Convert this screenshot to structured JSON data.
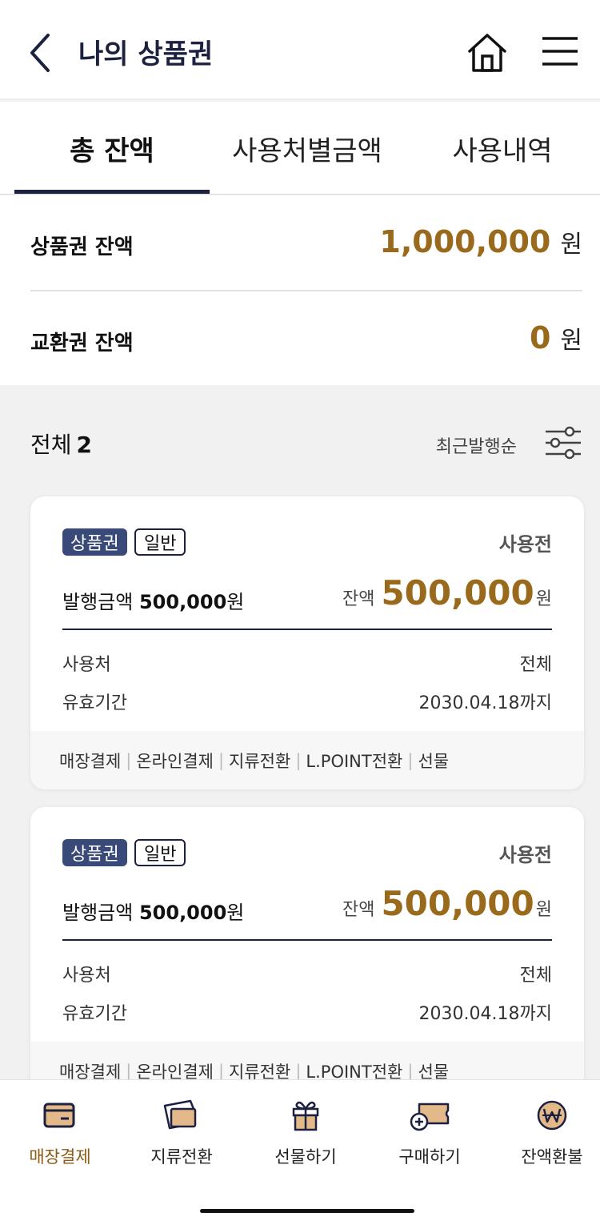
{
  "header": {
    "title": "나의 상품권",
    "back_icon": "chevron-left-icon",
    "home_icon": "home-icon",
    "menu_icon": "hamburger-menu-icon"
  },
  "tabs": [
    {
      "label": "총 잔액",
      "active": true
    },
    {
      "label": "사용처별금액",
      "active": false
    },
    {
      "label": "사용내역",
      "active": false
    }
  ],
  "balance": {
    "gift_label": "상품권 잔액",
    "gift_amount": "1,000,000",
    "exchange_label": "교환권 잔액",
    "exchange_amount": "0",
    "unit": "원"
  },
  "list": {
    "total_label": "전체",
    "total_count": "2",
    "sort_label": "최근발행순",
    "filter_icon": "filter-sliders-icon"
  },
  "cards": [
    {
      "badge_main": "상품권",
      "badge_sub": "일반",
      "status": "사용전",
      "issue_label": "발행금액",
      "issue_amount": "500,000",
      "issue_unit": "원",
      "remain_label": "잔액",
      "remain_amount": "500,000",
      "remain_unit": "원",
      "place_label": "사용처",
      "place_value": "전체",
      "expiry_label": "유효기간",
      "expiry_value": "2030.04.18까지",
      "actions": [
        "매장결제",
        "온라인결제",
        "지류전환",
        "L.POINT전환",
        "선물"
      ]
    },
    {
      "badge_main": "상품권",
      "badge_sub": "일반",
      "status": "사용전",
      "issue_label": "발행금액",
      "issue_amount": "500,000",
      "issue_unit": "원",
      "remain_label": "잔액",
      "remain_amount": "500,000",
      "remain_unit": "원",
      "place_label": "사용처",
      "place_value": "전체",
      "expiry_label": "유효기간",
      "expiry_value": "2030.04.18까지",
      "actions": [
        "매장결제",
        "온라인결제",
        "지류전환",
        "L.POINT전환",
        "선물"
      ]
    }
  ],
  "bottom_nav": [
    {
      "label": "매장결제",
      "icon": "card-payment-icon",
      "active": true
    },
    {
      "label": "지류전환",
      "icon": "ticket-convert-icon",
      "active": false
    },
    {
      "label": "선물하기",
      "icon": "gift-icon",
      "active": false
    },
    {
      "label": "구매하기",
      "icon": "ticket-buy-icon",
      "active": false
    },
    {
      "label": "잔액환불",
      "icon": "won-refund-icon",
      "active": false
    }
  ],
  "colors": {
    "navy": "#1c2140",
    "gold": "#9a6a1c",
    "badge": "#3a4a78"
  }
}
